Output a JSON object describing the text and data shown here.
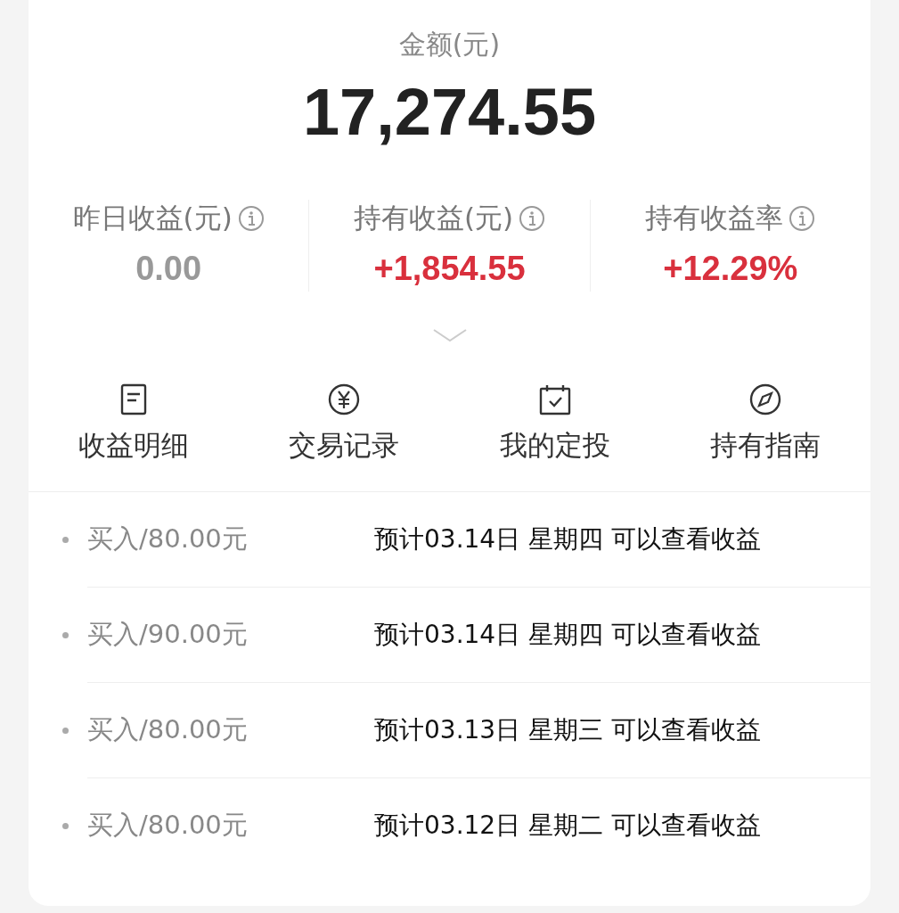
{
  "balance": {
    "label": "金额(元)",
    "amount": "17,274.55"
  },
  "stats": [
    {
      "label": "昨日收益(元)",
      "value": "0.00",
      "kind": "flat"
    },
    {
      "label": "持有收益(元)",
      "value": "+1,854.55",
      "kind": "gain"
    },
    {
      "label": "持有收益率",
      "value": "+12.29%",
      "kind": "gain"
    }
  ],
  "actions": [
    {
      "label": "收益明细",
      "kind": "document"
    },
    {
      "label": "交易记录",
      "kind": "yen"
    },
    {
      "label": "我的定投",
      "kind": "calendar"
    },
    {
      "label": "持有指南",
      "kind": "compass"
    }
  ],
  "records": [
    {
      "amount": "买入/80.00元",
      "note": "预计03.14日 星期四 可以查看收益"
    },
    {
      "amount": "买入/90.00元",
      "note": "预计03.14日 星期四 可以查看收益"
    },
    {
      "amount": "买入/80.00元",
      "note": "预计03.13日 星期三 可以查看收益"
    },
    {
      "amount": "买入/80.00元",
      "note": "预计03.12日 星期二 可以查看收益"
    }
  ]
}
